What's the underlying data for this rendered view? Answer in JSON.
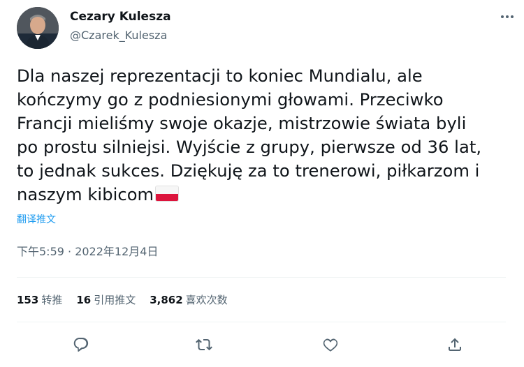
{
  "author": {
    "name": "Cezary Kulesza",
    "handle": "@Czarek_Kulesza"
  },
  "tweet": {
    "lines": [
      "Dla naszej reprezentacji to koniec Mundialu, ale",
      "kończymy go z podniesionymi głowami. Przeciwko",
      "Francji mieliśmy swoje okazje, mistrzowie świata byli",
      "po prostu silniejsi. Wyjście z grupy, pierwsze od 36 lat,",
      "to jednak sukces. Dziękuję za to trenerowi, piłkarzom i",
      "naszym kibicom"
    ],
    "translate_label": "翻译推文",
    "timestamp": "下午5:59 · 2022年12月4日"
  },
  "stats": {
    "retweets_count": "153",
    "retweets_label": "转推",
    "quotes_count": "16",
    "quotes_label": "引用推文",
    "likes_count": "3,862",
    "likes_label": "喜欢次数"
  },
  "icons": {
    "more": "more-icon",
    "reply": "reply-icon",
    "retweet": "retweet-icon",
    "like": "like-icon",
    "share": "share-icon",
    "flag": "poland-flag-emoji"
  },
  "colors": {
    "link": "#1d9bf0",
    "secondary_text": "#536471",
    "primary_text": "#0f1419"
  }
}
